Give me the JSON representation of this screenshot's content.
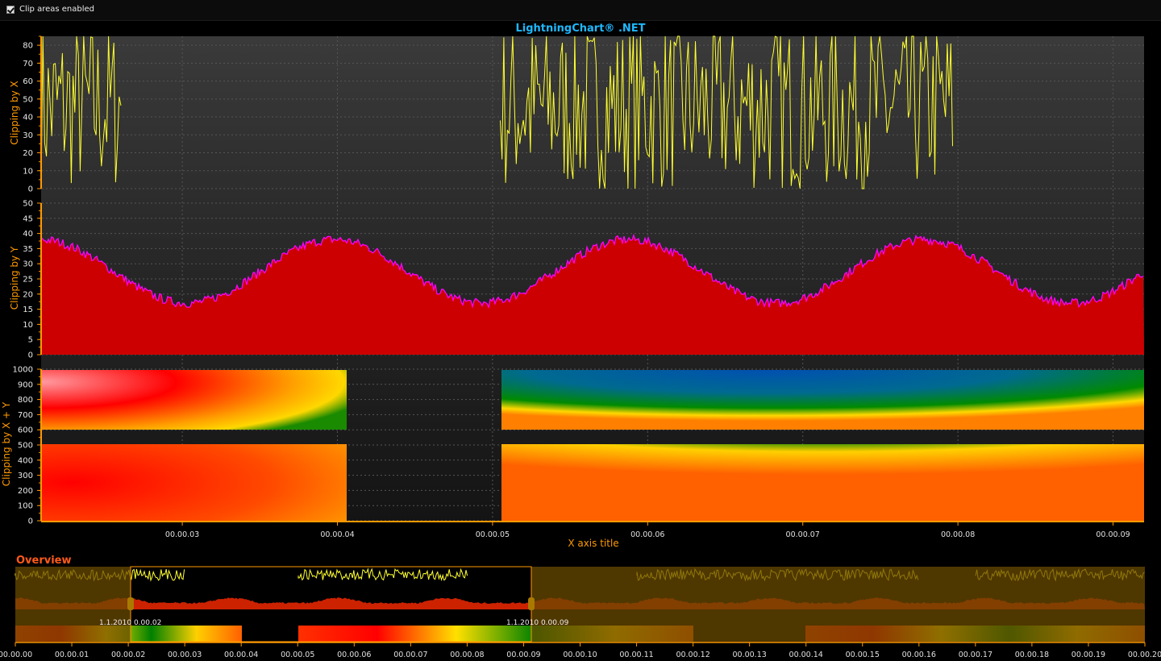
{
  "topbar": {
    "clip_label": "Clip areas enabled",
    "clip_checked": true
  },
  "colors": {
    "title": "#1fb8ff",
    "axis": "#ff9a00",
    "overview_title": "#ff5a1a",
    "trace": "#ffff30",
    "area_fill": "#cc0000",
    "area_line": "#ff00ff",
    "bg": "#2a2a2a"
  },
  "chart_data": [
    {
      "name": "clip-x",
      "type": "line",
      "title": "LightningChart® .NET",
      "ylabel": "Clipping by X",
      "ylim": [
        0,
        85
      ],
      "yticks": [
        "80",
        "70",
        "60",
        "50",
        "40",
        "30",
        "20",
        "10",
        "0"
      ],
      "x_visible": [
        0.0209,
        0.0302
      ],
      "clip_x": [
        [
          0.0209,
          0.0261
        ],
        [
          0.0505,
          0.0797
        ]
      ],
      "series": [
        {
          "name": "noise",
          "y_range": [
            0,
            85
          ]
        }
      ]
    },
    {
      "name": "clip-y",
      "type": "area",
      "ylabel": "Clipping by Y",
      "ylim": [
        0,
        50
      ],
      "yticks": [
        "50",
        "45",
        "40",
        "35",
        "30",
        "25",
        "20",
        "15",
        "10",
        "5",
        "0"
      ],
      "clip_y_max": 40,
      "series": [
        {
          "name": "sine",
          "baseline": 27.5,
          "amplitude": 10.5,
          "period": 0.019,
          "phase": 0.0208
        }
      ]
    },
    {
      "name": "clip-xy",
      "type": "heatmap",
      "ylabel": "Clipping by X + Y",
      "ylim": [
        0,
        1000
      ],
      "yticks": [
        "1000",
        "900",
        "800",
        "700",
        "600",
        "500",
        "400",
        "300",
        "200",
        "100",
        "0"
      ],
      "xlabel": "X axis title",
      "xticks": [
        "00.00.03",
        "00.00.04",
        "00.00.05",
        "00.00.06",
        "00.00.07",
        "00.00.08",
        "00.00.09"
      ],
      "clip_x": [
        [
          0.0209,
          0.0405
        ],
        [
          0.0505,
          0.092
        ]
      ],
      "clip_y": [
        [
          0,
          500
        ],
        [
          600,
          1000
        ]
      ]
    },
    {
      "name": "overview",
      "type": "line",
      "title": "Overview",
      "xlim": [
        0,
        0.02
      ],
      "xticks": [
        "00.00.00",
        "00.00.01",
        "00.00.02",
        "00.00.03",
        "00.00.04",
        "00.00.05",
        "00.00.06",
        "00.00.07",
        "00.00.08",
        "00.00.09",
        "00.00.10",
        "00.00.11",
        "00.00.12",
        "00.00.13",
        "00.00.14",
        "00.00.15",
        "00.00.16",
        "00.00.17",
        "00.00.18",
        "00.00.19",
        "00.00.20"
      ],
      "range_start_label": "1.1.2010 0.00.02",
      "range_end_label": "1.1.2010 0.00.09"
    }
  ]
}
